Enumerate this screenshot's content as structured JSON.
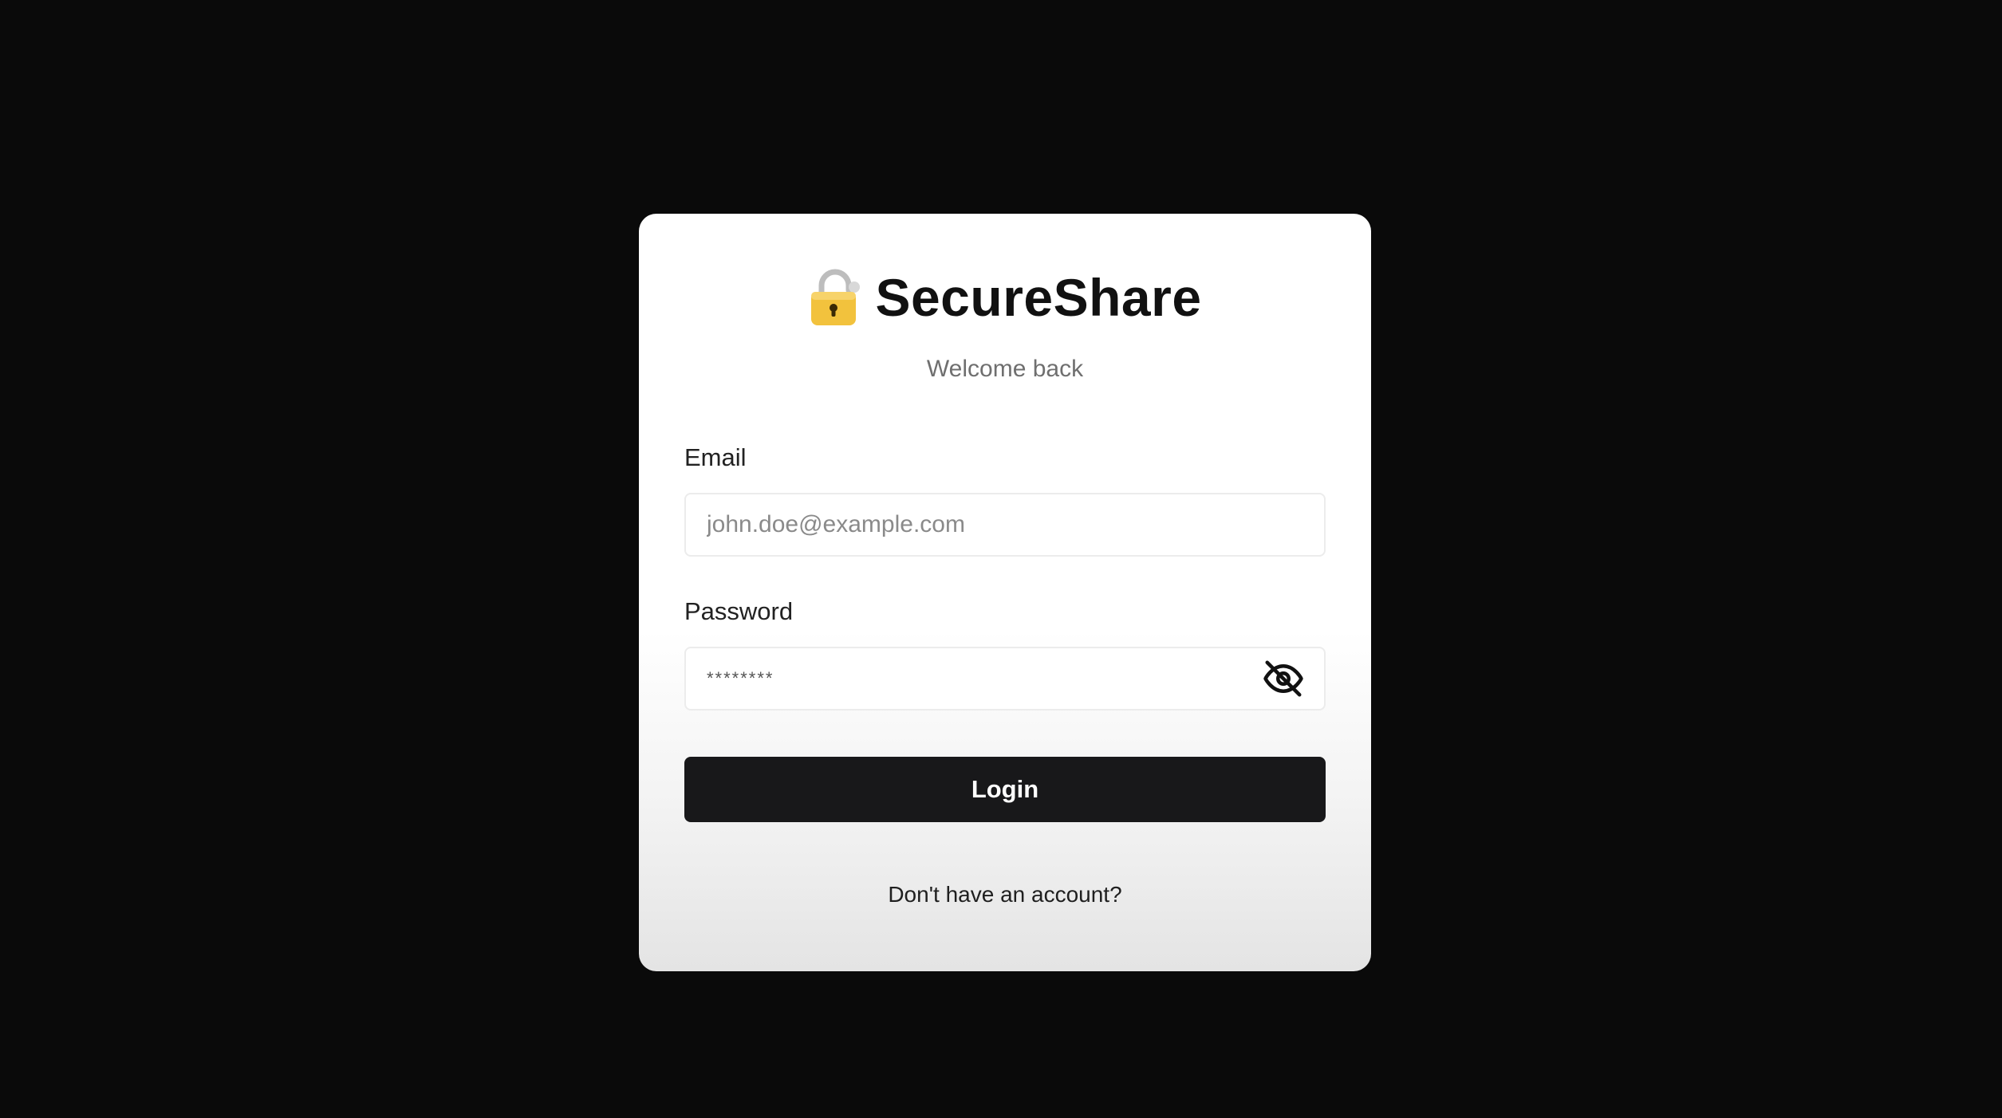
{
  "brand": {
    "title": "SecureShare",
    "icon": "lock-icon",
    "icon_color": "#F2C23D"
  },
  "subtitle": "Welcome back",
  "form": {
    "email_label": "Email",
    "email_placeholder": "john.doe@example.com",
    "email_value": "",
    "password_label": "Password",
    "password_value": "********",
    "password_visibility_icon": "eye-off-icon",
    "login_label": "Login"
  },
  "footer": {
    "signup_prompt": "Don't have an account?"
  },
  "colors": {
    "page_background": "#0A0A0A",
    "card_background": "#FFFFFF",
    "button_background": "#18181A",
    "button_text": "#FFFFFF",
    "subtitle_text": "#6F6F6F"
  }
}
